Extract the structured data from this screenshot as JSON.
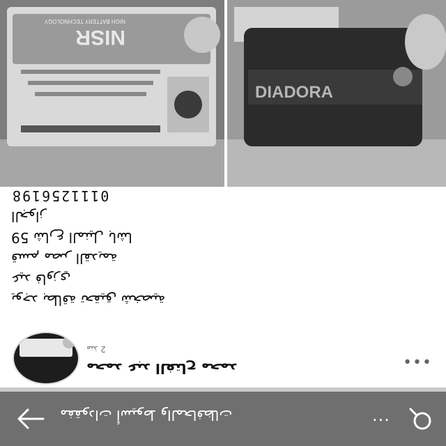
{
  "post": {
    "lines": [
      "0111256198",
      "الجواز",
      "59 شارع المنيل باشا",
      "قسم مصر القديمة",
      "عيد فاوزي",
      "يوجد بطاقة تحقيق شخصية"
    ]
  },
  "photo_left": {
    "brand_text": "NISR",
    "caption": "NIGH BATTERY TECHNOLOGY"
  },
  "photo_right": {
    "brand_text": "DIADORA"
  },
  "author": {
    "name": "محمد عبد الفتاح محمد",
    "time": "منذ 2",
    "more_icon": "•••"
  },
  "bottom_bar": {
    "title": "مفقودات أسيوط والمحافظات",
    "more_icon": "...",
    "back_icon": "arrow-left-icon",
    "search_icon": "search-icon"
  },
  "colors": {
    "bar": "#6f6f6f",
    "background": "#ffffff"
  }
}
